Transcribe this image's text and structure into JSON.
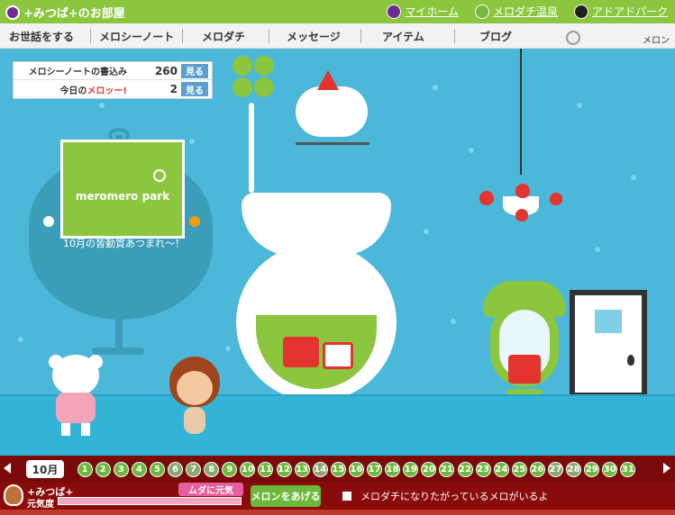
{
  "header": {
    "site_title": "+みつば+のお部屋",
    "links": [
      {
        "label": "マイホーム",
        "icon": "mero-face-icon",
        "color": "#6b2c91"
      },
      {
        "label": "メロダチ温泉",
        "icon": "frog-face-icon",
        "color": "#7ab53c"
      },
      {
        "label": "アドアドパーク",
        "icon": "black-face-icon",
        "color": "#222222"
      }
    ]
  },
  "nav": {
    "items": [
      "お世話をする",
      "メロシーノート",
      "メロダチ",
      "メッセージ",
      "アイテム",
      "ブログ"
    ],
    "user_label": "メロン"
  },
  "stats": {
    "note_label": "メロシーノートの書込み",
    "note_value": "260",
    "note_button": "見る",
    "today_prefix": "今日の",
    "today_logo": "メロッー!",
    "today_value": "2",
    "today_button": "見る"
  },
  "tv": {
    "brand": "meromero park",
    "ticker": "10月の皆勤賞あつまれ〜！"
  },
  "calendar": {
    "month": "10月",
    "days": [
      "1",
      "2",
      "3",
      "4",
      "5",
      "6",
      "7",
      "8",
      "9",
      "10",
      "11",
      "12",
      "13",
      "14",
      "15",
      "16",
      "17",
      "18",
      "19",
      "20",
      "21",
      "22",
      "23",
      "24",
      "25",
      "26",
      "27",
      "28",
      "29",
      "30",
      "31"
    ],
    "missed": [
      "6",
      "7",
      "8",
      "14",
      "27",
      "28"
    ]
  },
  "status": {
    "name": "+みつば+",
    "condition": "元気度",
    "mood": "ムダに元気",
    "give_button": "メロンをあげる",
    "message": "メロダチになりたがっているメロがいるよ"
  },
  "colors": {
    "topbar": "#8cc63f",
    "room_bg": "#4bb8d9",
    "calendar_bg": "#7a0a0a",
    "day_green": "#6bb83a",
    "button_blue": "#5aa0d0",
    "mood_pink": "#e85d9b"
  }
}
